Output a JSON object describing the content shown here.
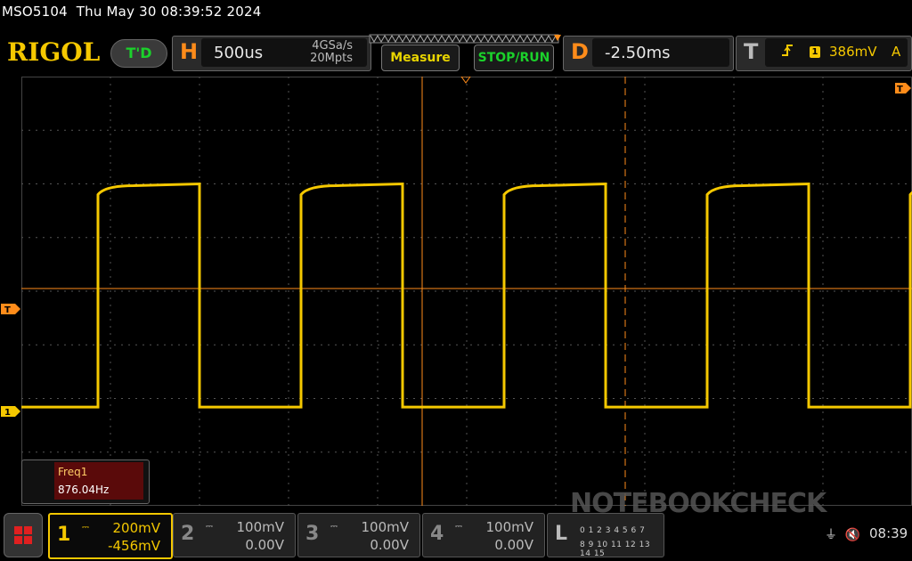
{
  "topbar": {
    "model": "MSO5104",
    "datetime": "Thu May 30 08:39:52 2024"
  },
  "brand": {
    "logo": "RIGOL",
    "mode_badge": "T'D"
  },
  "horizontal": {
    "letter": "H",
    "timebase": "500us",
    "sample_rate": "4GSa/s",
    "memory_depth": "20Mpts"
  },
  "buttons": {
    "measure": "Measure",
    "stop_run": "STOP/RUN"
  },
  "delay": {
    "letter": "D",
    "value": "-2.50ms"
  },
  "trigger": {
    "letter": "T",
    "edge_icon": "rising-edge-icon",
    "source": "1",
    "level": "386mV",
    "mode": "A"
  },
  "screen_markers": {
    "trigger_marker": "T",
    "channel1_marker": "1",
    "right_trigger_marker": "T"
  },
  "measurement": {
    "name": "Freq1",
    "value": "876.04Hz"
  },
  "channels": [
    {
      "num": "1",
      "coupling": "DC",
      "scale": "200mV",
      "offset": "-456mV"
    },
    {
      "num": "2",
      "coupling": "DC",
      "scale": "100mV",
      "offset": "0.00V"
    },
    {
      "num": "3",
      "coupling": "DC",
      "scale": "100mV",
      "offset": "0.00V"
    },
    {
      "num": "4",
      "coupling": "DC",
      "scale": "100mV",
      "offset": "0.00V"
    }
  ],
  "logic": {
    "letter": "L",
    "row1": "0 1 2 3 4 5 6 7",
    "row2": "8 9 10 11 12 13 14 15"
  },
  "status": {
    "usb_icon": "usb-icon",
    "speaker_icon": "muted-speaker-icon",
    "time": "08:39"
  },
  "watermark": "NOTEBOOKCHECK",
  "colors": {
    "channel1": "#f5c800",
    "trigger": "#ff8c1a",
    "accent_green": "#1bd12b"
  },
  "waveform": {
    "high_level_fraction": 0.25,
    "low_level_fraction": 0.77,
    "period_divisions": 2.28
  }
}
